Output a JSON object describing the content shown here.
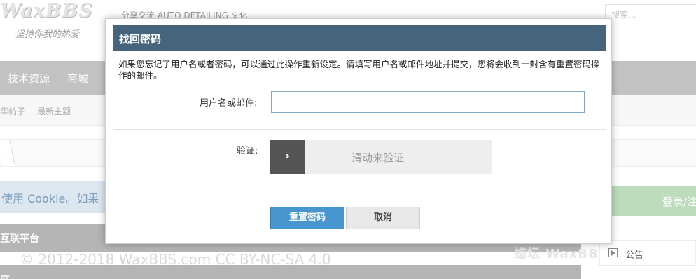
{
  "site": {
    "logo_text": "WaxBBS",
    "logo_slogan": "坚持你我的热爱",
    "tagline": "分享交流 AUTO DETAILING 文化",
    "search_placeholder": "搜索..."
  },
  "nav": {
    "items": [
      "技术资源",
      "商城"
    ]
  },
  "subnav": {
    "items": [
      "华帖子",
      "最新主题"
    ]
  },
  "page": {
    "cookie_text": "使用 Cookie。如果",
    "section1_title": "互联平台",
    "section2_title": "区",
    "footer_copyright": "© 2012-2018 WaxBBS.com CC BY-NC-SA 4.0",
    "login_label": "登录/注",
    "notice_label": "公告",
    "watermark": "蜡坛 WaxBBS"
  },
  "dialog": {
    "title": "找回密码",
    "intro": "如果您忘记了用户名或者密码，可以通过此操作重新设定。请填写用户名或邮件地址并提交，您将会收到一封含有重置密码操作的邮件。",
    "username_label": "用户名或邮件:",
    "username_value": "",
    "captcha_label": "验证:",
    "slider_handle_glyph": "›",
    "slider_text": "滑动来验证",
    "submit_label": "重置密码",
    "cancel_label": "取消"
  },
  "icons": {
    "slider_handle": "chevron-right-icon",
    "notice": "notice-icon"
  },
  "colors": {
    "dialog_header": "#46657c",
    "primary_button": "#4896cf",
    "nav_bar": "#c2c2c2"
  }
}
